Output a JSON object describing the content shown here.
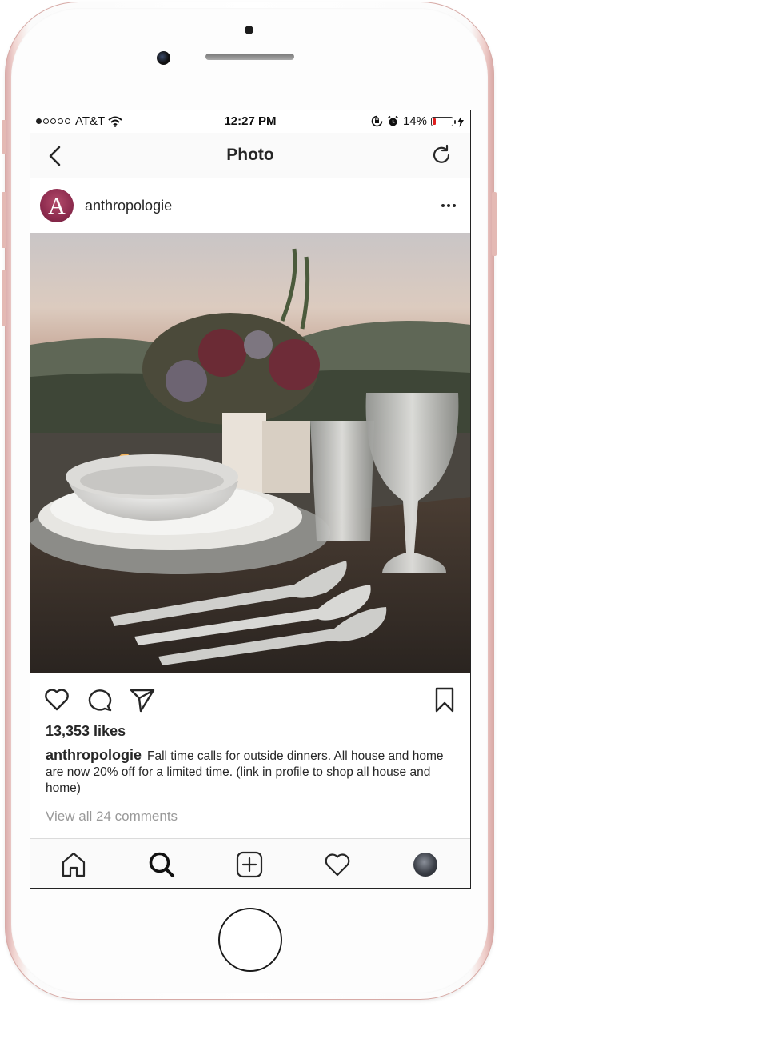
{
  "status_bar": {
    "carrier": "AT&T",
    "time": "12:27 PM",
    "battery_percent": "14%",
    "battery_level": 0.14,
    "signal_bars_filled": 1,
    "signal_bars_total": 5
  },
  "nav": {
    "title": "Photo",
    "back_icon": "chevron-left-icon",
    "refresh_icon": "refresh-icon"
  },
  "post": {
    "avatar_letter": "A",
    "username": "anthropologie",
    "likes": "13,353 likes",
    "caption_user": "anthropologie",
    "caption_text": "Fall time calls for outside dinners. All house and home are now 20% off for a limited time. (link in profile to shop all house and home)",
    "view_comments": "View all 24 comments"
  },
  "tabs": [
    {
      "name": "home",
      "icon": "home-icon"
    },
    {
      "name": "search",
      "icon": "search-icon"
    },
    {
      "name": "new-post",
      "icon": "plus-square-icon"
    },
    {
      "name": "activity",
      "icon": "heart-icon"
    },
    {
      "name": "profile",
      "icon": "avatar"
    }
  ],
  "colors": {
    "phone_frame": "#e4b9b4",
    "text": "#262626",
    "muted": "#999999",
    "battery_low": "#e02020",
    "avatar_brand": "#8d2b4e"
  }
}
